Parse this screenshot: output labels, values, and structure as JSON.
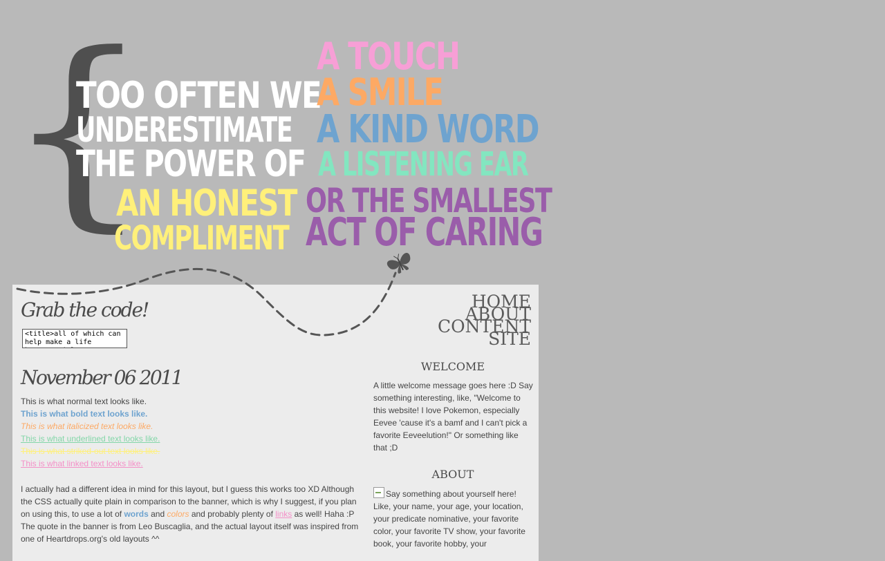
{
  "banner": {
    "brace": "{",
    "line1": "TOO OFTEN WE",
    "line2": "UNDERESTIMATE",
    "line3": "THE POWER OF",
    "line4": "AN HONEST",
    "line5": "COMPLIMENT",
    "r1": "A TOUCH",
    "r2": "A SMILE",
    "r3": "A KIND WORD",
    "r4": "A LISTENING EAR",
    "r5": "OR THE SMALLEST",
    "r6": "ACT OF CARING"
  },
  "grab": {
    "title": "Grab the code!",
    "code": "<title>all of which can help make a life better</title>"
  },
  "post": {
    "date": "November 06 2011",
    "normal": "This is what normal text looks like.",
    "bold": "This is what bold text looks like.",
    "italic": "This is what italicized text looks like.",
    "underline": "This is what underlined text looks like.",
    "strike": "This is what striked-out text looks like.",
    "link": "This is what linked text looks like.",
    "p1": "I actually had a different idea in mind for this layout, but I guess this works too XD Although the CSS actually quite plain in comparison to the banner, which is why I suggest, if you plan on using this, to use a lot of ",
    "w_words": "words",
    "p2": " and ",
    "w_colors": "colors",
    "p3": " and probably plenty of ",
    "w_links": "links",
    "p4": " as well! Haha :P The quote in the banner is from Leo Buscaglia, and the actual layout itself was inspired from one of Heartdrops.org's old layouts ^^"
  },
  "nav": {
    "home": "HOME",
    "about": "ABOUT",
    "content": "CONTENT",
    "site": "SITE"
  },
  "sidebar": {
    "welcome_title": "WELCOME",
    "welcome_text": "A little welcome message goes here :D Say something interesting, like, \"Welcome to this website! I love Pokemon, especially Eevee 'cause it's a bamf and I can't pick a favorite Eeveelution!\" Or something like that ;D",
    "about_title": "ABOUT",
    "about_text": "Say something about yourself here! Like, your name, your age, your location, your predicate nominative, your favorite color, your favorite TV show, your favorite book, your favorite hobby, your"
  },
  "colors": {
    "background": "#b9b9b9",
    "panel": "#ececec",
    "brace": "#4f4f4f",
    "yellow": "#fff07a",
    "pink": "#f79fd6",
    "orange": "#fda964",
    "blue": "#6ea3cf",
    "mint": "#83e6c0",
    "purple": "#9a5daa"
  },
  "icons": {
    "butterfly": "butterfly-icon",
    "broken_image": "broken-image-icon"
  }
}
